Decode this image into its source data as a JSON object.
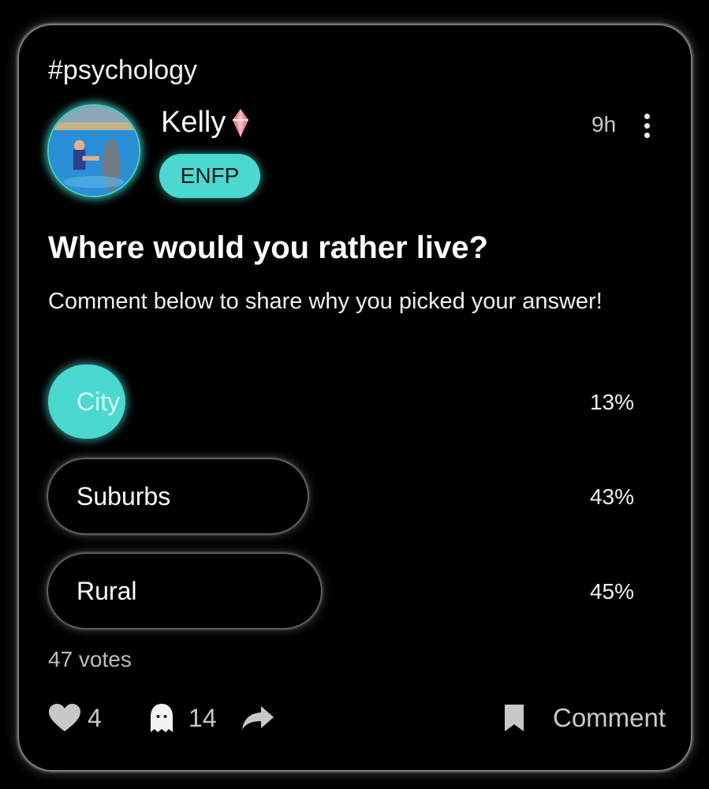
{
  "post": {
    "tag": "#psychology",
    "author": {
      "name": "Kelly",
      "mbti": "ENFP",
      "badge_icon": "pink-gem-icon"
    },
    "time": "9h",
    "question": "Where would you rather live?",
    "description": "Comment below to share why you picked your answer!"
  },
  "poll": {
    "options": [
      {
        "label": "City",
        "percent": "13%",
        "value": 13,
        "selected": true
      },
      {
        "label": "Suburbs",
        "percent": "43%",
        "value": 43,
        "selected": false
      },
      {
        "label": "Rural",
        "percent": "45%",
        "value": 45,
        "selected": false
      }
    ],
    "votes": "47 votes"
  },
  "actions": {
    "likes": "4",
    "ghost_count": "14",
    "comment_label": "Comment"
  },
  "colors": {
    "accent": "#4ad8cf",
    "background": "#000000",
    "gem": "#f08a9a"
  }
}
